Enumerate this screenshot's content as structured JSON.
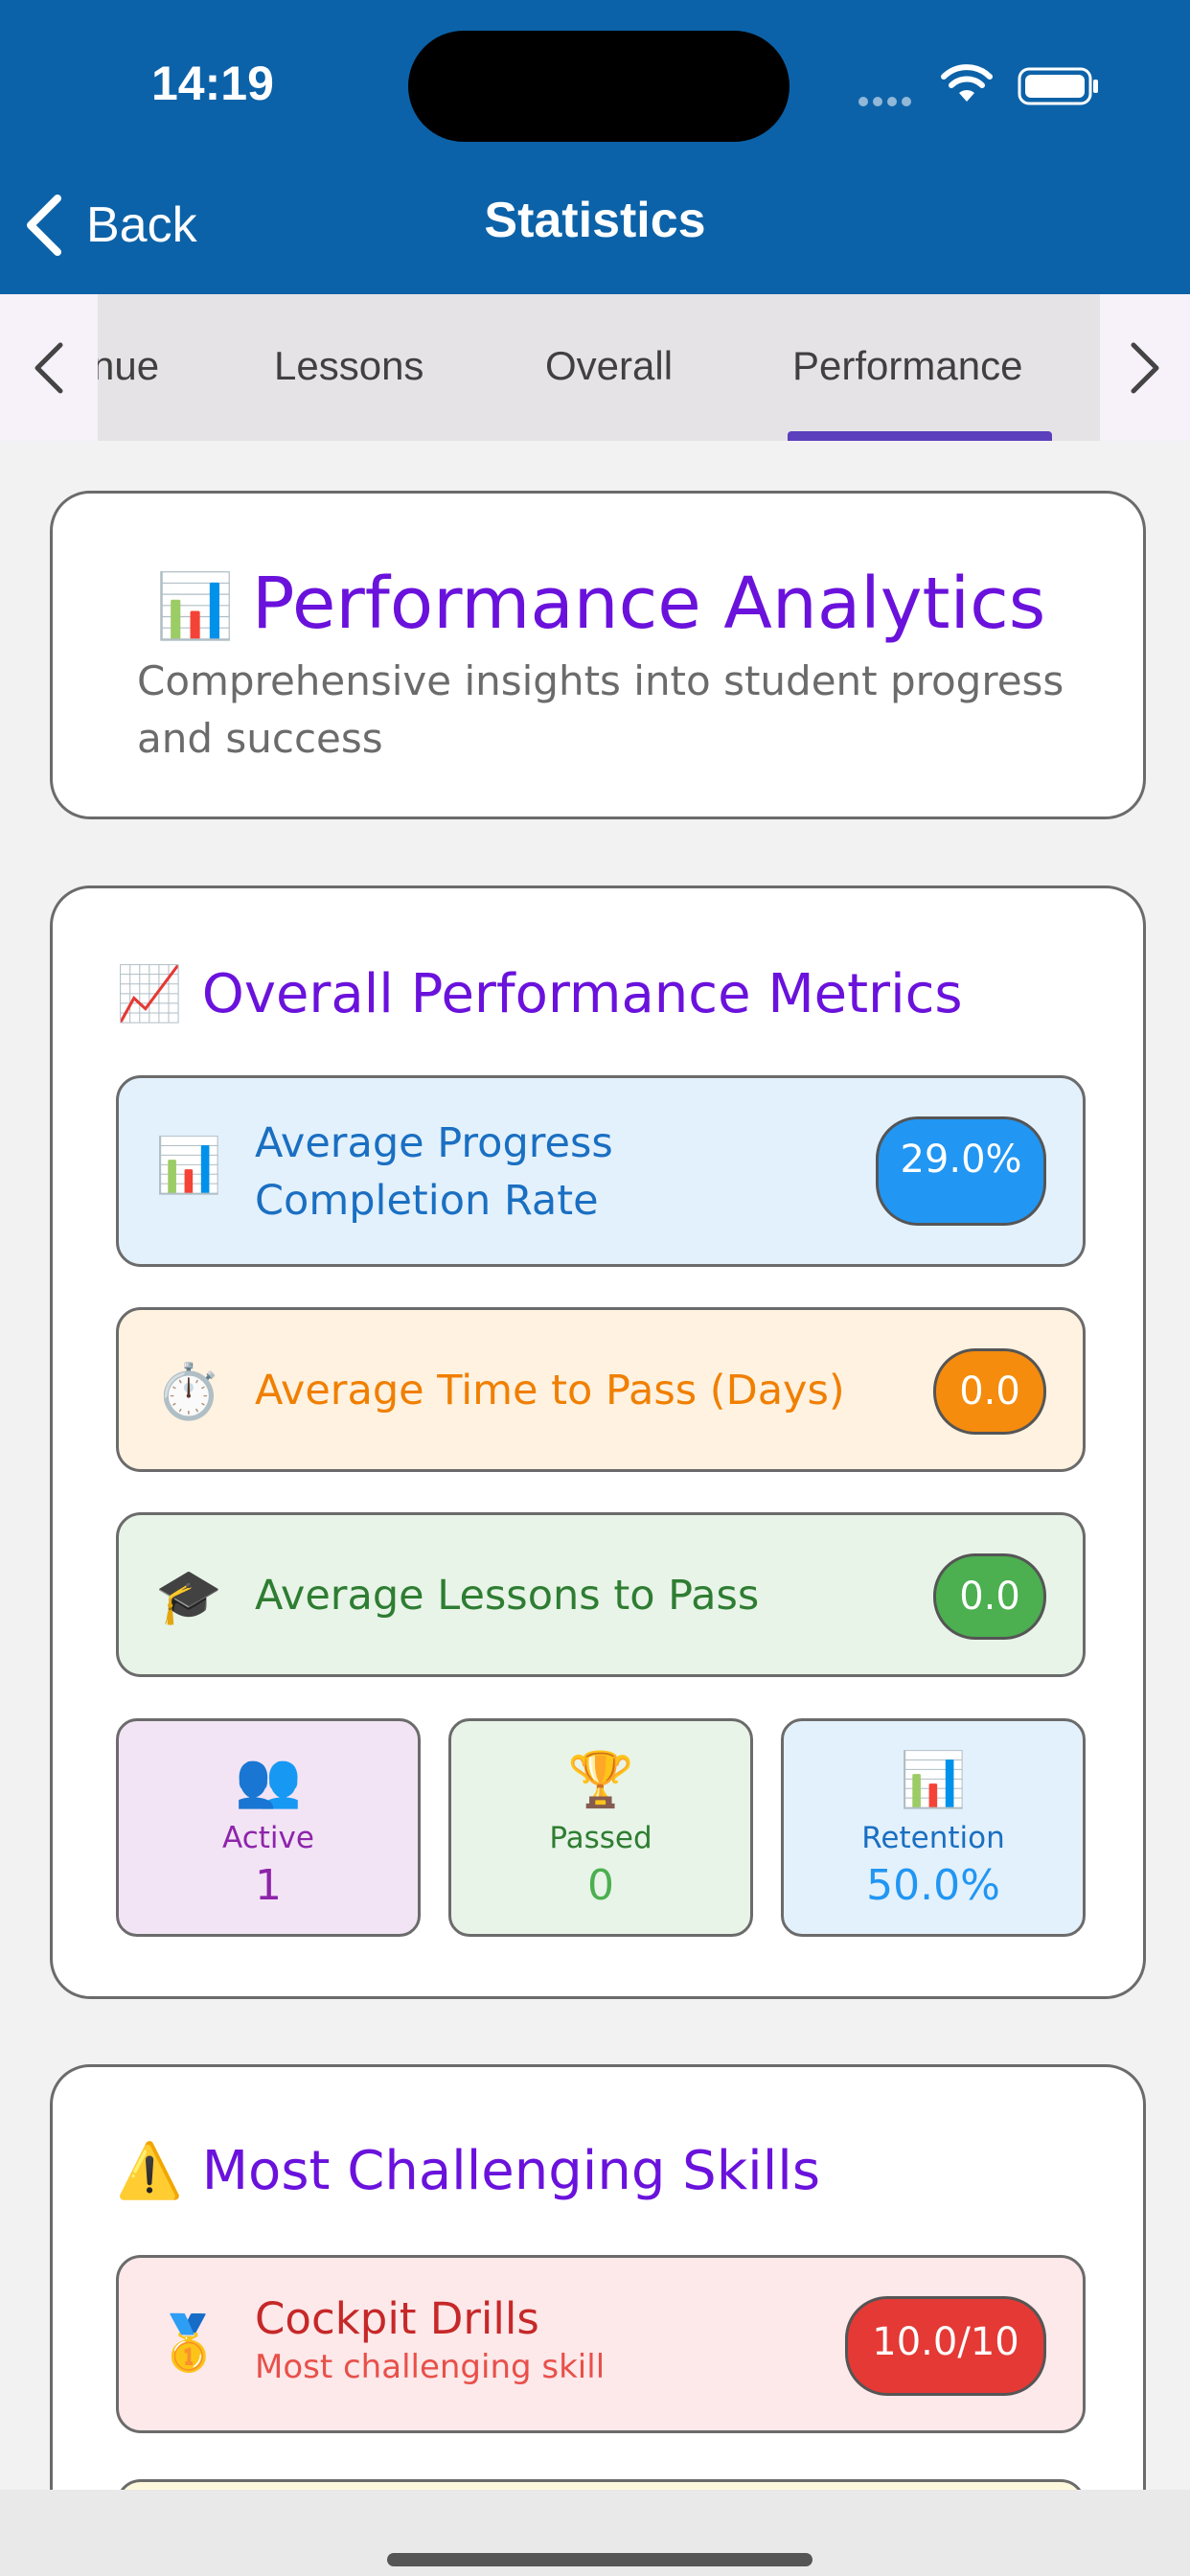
{
  "status": {
    "time": "14:19"
  },
  "nav": {
    "back_label": "Back",
    "title": "Statistics"
  },
  "tabs": [
    {
      "label": "nue"
    },
    {
      "label": "Lessons"
    },
    {
      "label": "Overall"
    },
    {
      "label": "Performance",
      "active": true
    }
  ],
  "hero": {
    "icon": "📊",
    "title": "Performance Analytics",
    "subtitle": "Comprehensive insights into student progress and success"
  },
  "metrics_section": {
    "icon": "📈",
    "title": "Overall Performance Metrics",
    "rows": [
      {
        "icon": "📊",
        "label": "Average Progress Completion Rate",
        "value": "29.0%",
        "color": "#2196f3",
        "bg": "#e3f1fc",
        "text_color": "#1a6fc2"
      },
      {
        "icon": "⏱️",
        "label": "Average Time to Pass (Days)",
        "value": "0.0",
        "color": "#f58c0d",
        "bg": "#fff2e1",
        "text_color": "#f07f00"
      },
      {
        "icon": "🎓",
        "label": "Average Lessons to Pass",
        "value": "0.0",
        "color": "#4caf50",
        "bg": "#e8f4e8",
        "text_color": "#2e7d32"
      }
    ],
    "stats": [
      {
        "icon": "👥",
        "label": "Active",
        "value": "1",
        "bg": "#f2e4f5",
        "color": "#8e24aa"
      },
      {
        "icon": "🏆",
        "label": "Passed",
        "value": "0",
        "bg": "#e8f4e8",
        "color": "#2e7d32"
      },
      {
        "icon": "📊",
        "label": "Retention",
        "value": "50.0%",
        "bg": "#e3f1fc",
        "color": "#1e88e5"
      }
    ]
  },
  "challenging_section": {
    "icon": "⚠️",
    "title": "Most Challenging Skills",
    "items": [
      {
        "icon": "🥇",
        "name": "Cockpit Drills",
        "subtitle": "Most challenging skill",
        "score": "10.0/10",
        "color": "#e53935",
        "bg": "#fde8ea"
      }
    ]
  }
}
